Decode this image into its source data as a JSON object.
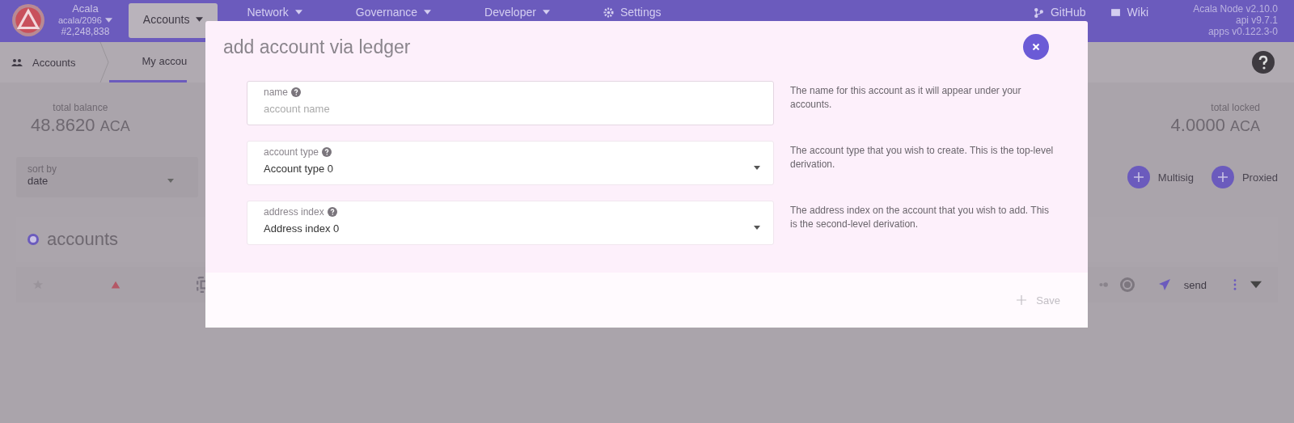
{
  "header": {
    "chain": {
      "name": "Acala",
      "account": "acala/2096",
      "block": "#2,248,838"
    },
    "nav": [
      {
        "label": "Accounts",
        "selected": true,
        "kind": "menu"
      },
      {
        "label": "Network",
        "selected": false,
        "kind": "menu"
      },
      {
        "label": "Governance",
        "selected": false,
        "kind": "menu"
      },
      {
        "label": "Developer",
        "selected": false,
        "kind": "menu"
      },
      {
        "label": "Settings",
        "selected": false,
        "kind": "settings"
      }
    ],
    "links": [
      {
        "label": "GitHub",
        "kind": "github"
      },
      {
        "label": "Wiki",
        "kind": "wiki"
      }
    ],
    "versions": [
      "Acala Node v2.10.0",
      "api v9.7.1",
      "apps v0.122.3-0"
    ]
  },
  "breadcrumb": [
    {
      "label": "Accounts",
      "selected": false
    },
    {
      "label": "My accou",
      "selected": true
    }
  ],
  "summary": {
    "balance": {
      "label": "total balance",
      "value": "48.8620",
      "unit": "ACA"
    },
    "locked": {
      "label": "total locked",
      "value": "4.0000",
      "unit": "ACA"
    }
  },
  "sort": {
    "label": "sort by",
    "value": "date"
  },
  "actions": [
    "Multisig",
    "Proxied"
  ],
  "accounts": {
    "title": "accounts",
    "row": {
      "send": "send"
    }
  },
  "modal": {
    "title": "add account via ledger",
    "fields": [
      {
        "kind": "input",
        "label": "name",
        "placeholder": "account name",
        "description": "The name for this account as it will appear under your accounts."
      },
      {
        "kind": "select",
        "label": "account type",
        "value": "Account type 0",
        "description": "The account type that you wish to create. This is the top-level derivation."
      },
      {
        "kind": "select",
        "label": "address index",
        "value": "Address index 0",
        "description": "The address index on the account that you wish to add. This is the second-level derivation."
      }
    ],
    "save": {
      "label": "Save",
      "disabled": true
    }
  }
}
